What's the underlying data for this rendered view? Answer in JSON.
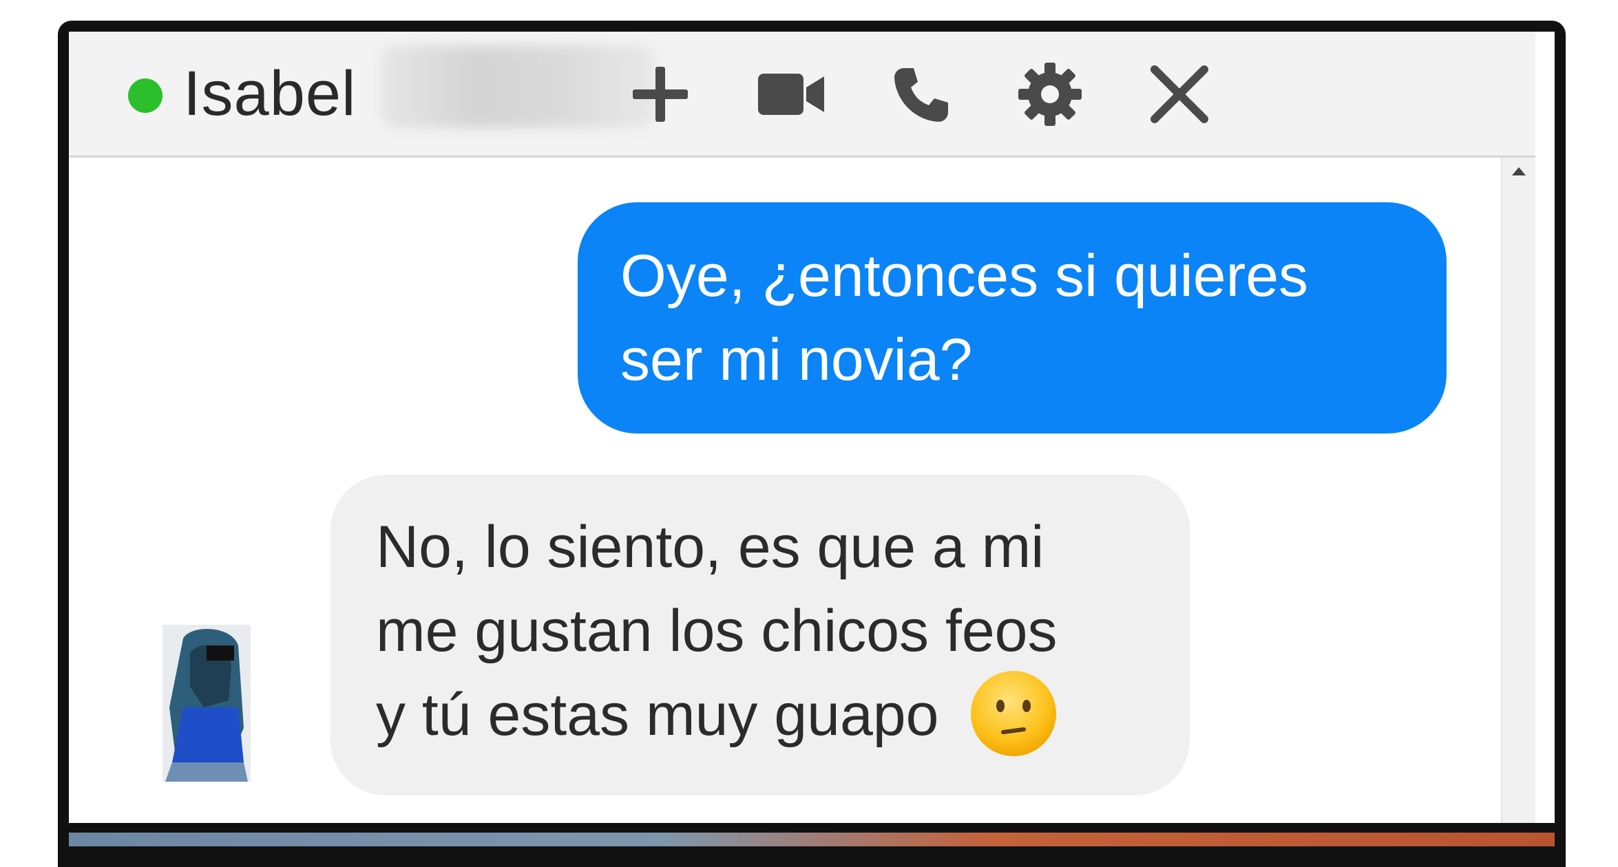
{
  "header": {
    "contact_name": "Isabel",
    "presence": "online",
    "buttons": {
      "add": "plus-icon",
      "video": "video-camera-icon",
      "call": "phone-icon",
      "settings": "gear-icon",
      "close": "close-icon"
    }
  },
  "messages": [
    {
      "direction": "outgoing",
      "lines": [
        "Oye, ¿entonces si quieres",
        "ser mi novia?"
      ]
    },
    {
      "direction": "incoming",
      "lines": [
        "No, lo siento, es que a mi",
        "me gustan los chicos feos",
        "y tú estas muy guapo"
      ],
      "emoji": "confused-face-icon"
    }
  ],
  "colors": {
    "outgoing_bubble": "#0a84f6",
    "incoming_bubble": "#f1f0f0",
    "presence_online": "#2bbf2b",
    "header_bg": "#f3f3f4"
  }
}
